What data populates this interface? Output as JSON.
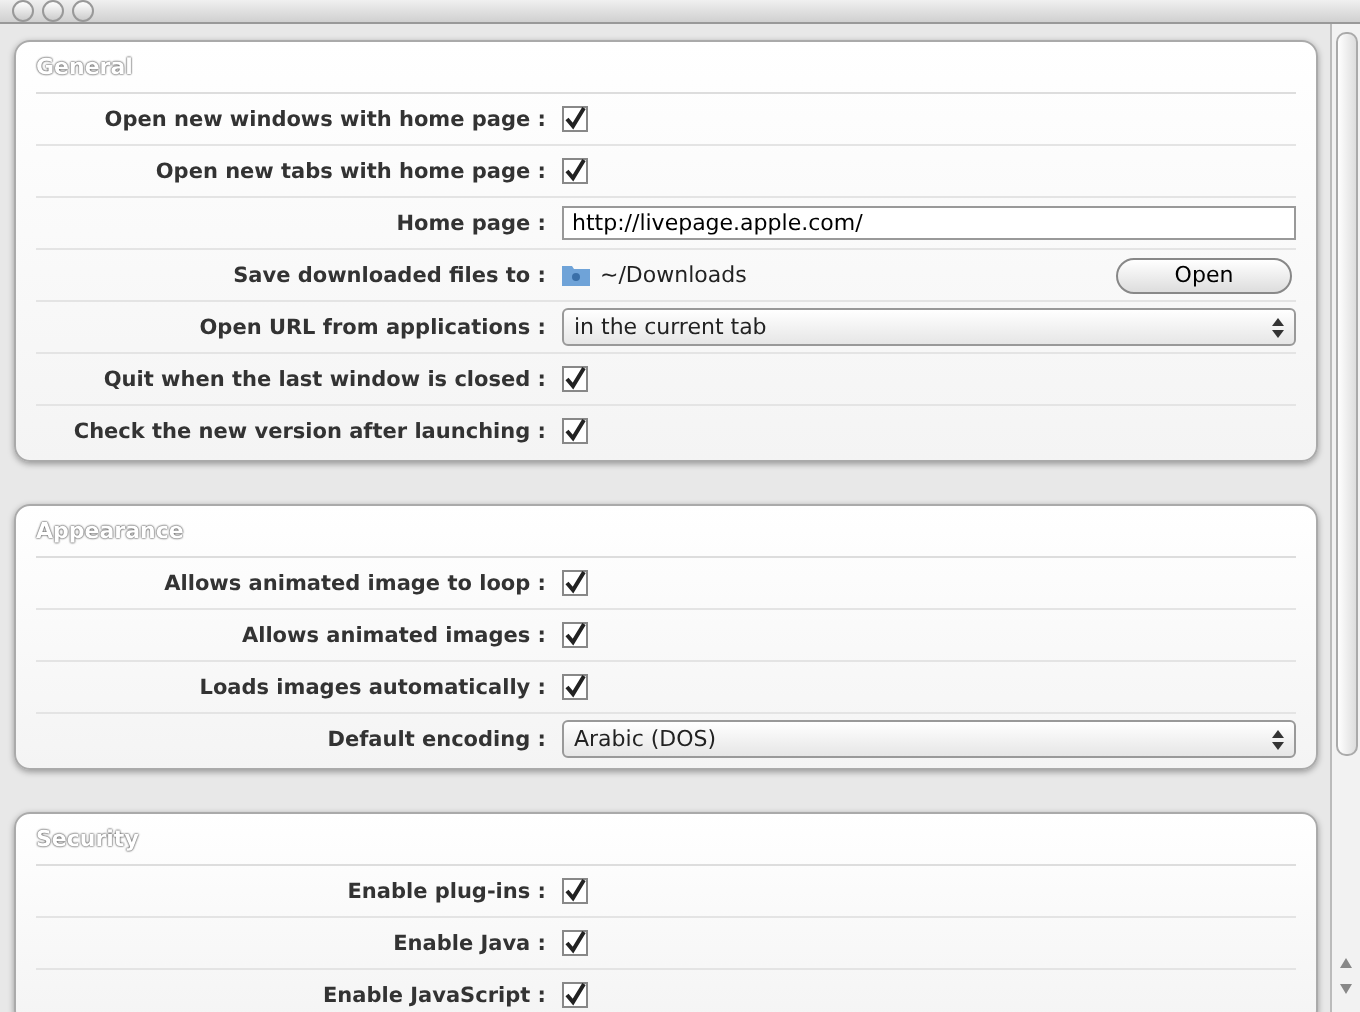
{
  "sections": [
    {
      "title": "General",
      "rows": [
        {
          "kind": "checkbox",
          "label": "Open new windows with home page :",
          "checked": true
        },
        {
          "kind": "checkbox",
          "label": "Open new tabs with home page :",
          "checked": true
        },
        {
          "kind": "text",
          "label": "Home page :",
          "value": "http://livepage.apple.com/"
        },
        {
          "kind": "folder",
          "label": "Save downloaded files to :",
          "value": "~/Downloads",
          "button": "Open"
        },
        {
          "kind": "select",
          "label": "Open URL from applications :",
          "value": "in the current tab"
        },
        {
          "kind": "checkbox",
          "label": "Quit when the last window is closed :",
          "checked": true
        },
        {
          "kind": "checkbox",
          "label": "Check the new version after launching :",
          "checked": true
        }
      ]
    },
    {
      "title": "Appearance",
      "rows": [
        {
          "kind": "checkbox",
          "label": "Allows animated image to loop :",
          "checked": true
        },
        {
          "kind": "checkbox",
          "label": "Allows animated images :",
          "checked": true
        },
        {
          "kind": "checkbox",
          "label": "Loads images automatically :",
          "checked": true
        },
        {
          "kind": "select",
          "label": "Default encoding :",
          "value": "Arabic (DOS)"
        }
      ]
    },
    {
      "title": "Security",
      "rows": [
        {
          "kind": "checkbox",
          "label": "Enable plug-ins :",
          "checked": true
        },
        {
          "kind": "checkbox",
          "label": "Enable Java :",
          "checked": true
        },
        {
          "kind": "checkbox",
          "label": "Enable JavaScript :",
          "checked": true
        }
      ]
    }
  ]
}
